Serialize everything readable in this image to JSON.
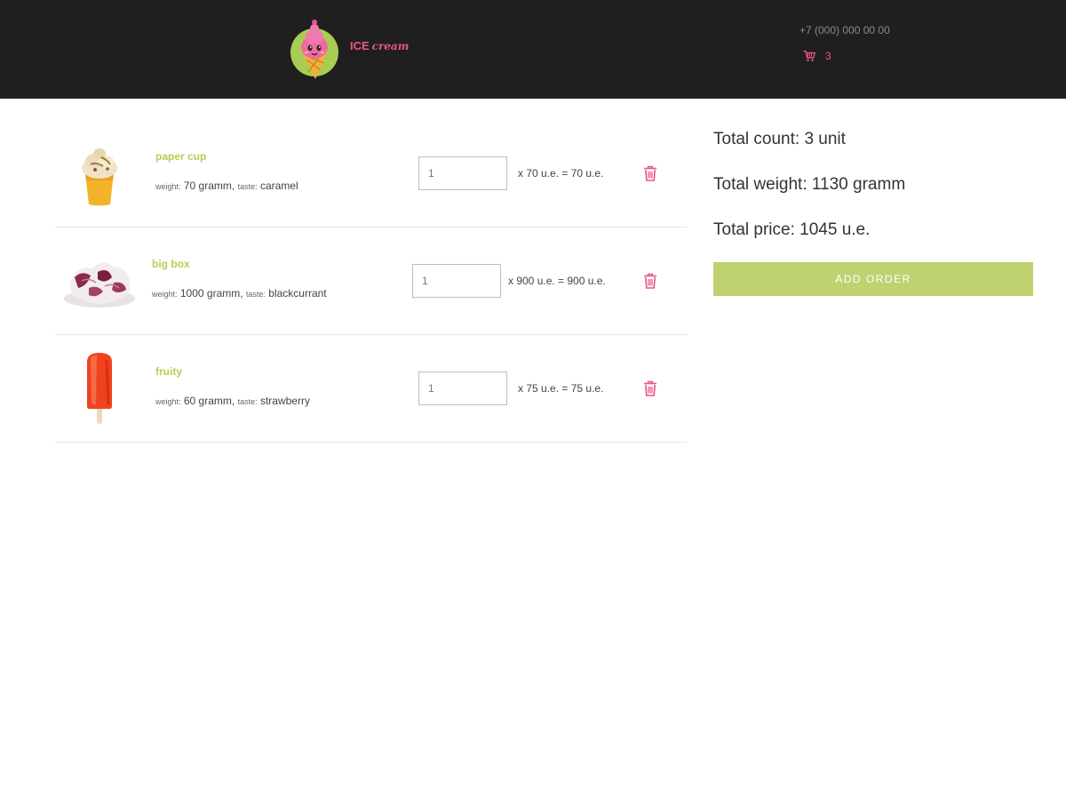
{
  "header": {
    "logo_ice": "ICE",
    "logo_cream": "cream",
    "phone": "+7 (000) 000 00 00",
    "cart_count": "3"
  },
  "cart": {
    "items": [
      {
        "name": "paper cup",
        "weight_label": "weight:",
        "weight": "70 gramm,",
        "taste_label": "taste:",
        "taste": "caramel",
        "quantity": "1",
        "price_line": "x 70 u.e. = 70 u.e.",
        "image_icon": "ice-cream-paper-cup-image",
        "image_color": "#f2b32a"
      },
      {
        "name": "big box",
        "weight_label": "weight:",
        "weight": "1000 gramm,",
        "taste_label": "taste:",
        "taste": "blackcurrant",
        "quantity": "1",
        "price_line": "x 900 u.e. = 900 u.e.",
        "image_icon": "ice-cream-big-box-image",
        "image_color": "#8c2a4e"
      },
      {
        "name": "fruity",
        "weight_label": "weight:",
        "weight": "60 gramm,",
        "taste_label": "taste:",
        "taste": "strawberry",
        "quantity": "1",
        "price_line": "x 75 u.e. = 75 u.e.",
        "image_icon": "popsicle-image",
        "image_color": "#f0421f"
      }
    ]
  },
  "summary": {
    "total_count": "Total count: 3 unit",
    "total_weight": "Total weight: 1130 gramm",
    "total_price": "Total price: 1045 u.e.",
    "add_order_label": "ADD ORDER"
  },
  "colors": {
    "accent_pink": "#e8558a",
    "accent_green": "#b5cf55",
    "button_green": "#bed270",
    "header_bg": "#1f1f1f"
  }
}
